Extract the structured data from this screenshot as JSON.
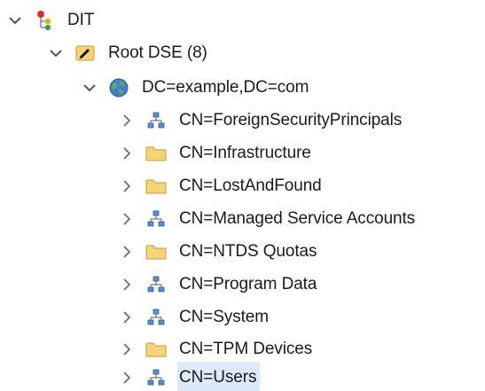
{
  "tree": {
    "root": {
      "label": "DIT",
      "icon": "tree-hierarchy-icon",
      "expanded": true
    },
    "rootdse": {
      "label": "Root DSE (8)",
      "icon": "pencil-folder-icon",
      "expanded": true
    },
    "domain": {
      "label": "DC=example,DC=com",
      "icon": "globe-icon",
      "expanded": true
    },
    "children": [
      {
        "label": "CN=ForeignSecurityPrincipals",
        "icon": "container-icon",
        "expanded": false
      },
      {
        "label": "CN=Infrastructure",
        "icon": "folder-icon",
        "expanded": false
      },
      {
        "label": "CN=LostAndFound",
        "icon": "folder-icon",
        "expanded": false
      },
      {
        "label": "CN=Managed Service Accounts",
        "icon": "container-icon",
        "expanded": false
      },
      {
        "label": "CN=NTDS Quotas",
        "icon": "folder-icon",
        "expanded": false
      },
      {
        "label": "CN=Program Data",
        "icon": "container-icon",
        "expanded": false
      },
      {
        "label": "CN=System",
        "icon": "container-icon",
        "expanded": false
      },
      {
        "label": "CN=TPM Devices",
        "icon": "folder-icon",
        "expanded": false
      },
      {
        "label": "CN=Users",
        "icon": "container-icon",
        "expanded": false,
        "selected": true
      }
    ]
  },
  "colors": {
    "selection": "#dbe9f8",
    "folder": "#f6d27a",
    "container": "#5a8fc7",
    "chevron": "#666666"
  }
}
